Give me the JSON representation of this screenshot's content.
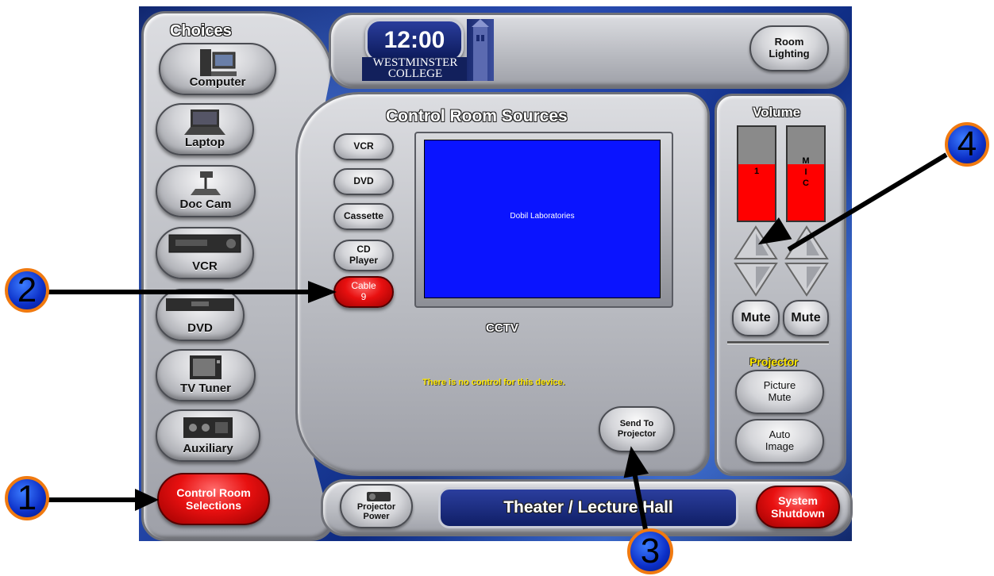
{
  "clock": "12:00",
  "logo_text": {
    "line1": "WESTMINSTER",
    "line2": "COLLEGE"
  },
  "room_lighting": {
    "line1": "Room",
    "line2": "Lighting"
  },
  "choices": {
    "title": "Choices",
    "items": [
      {
        "label": "Computer",
        "icon": "computer-icon"
      },
      {
        "label": "Laptop",
        "icon": "laptop-icon"
      },
      {
        "label": "Doc Cam",
        "icon": "doc-cam-icon"
      },
      {
        "label": "VCR",
        "icon": "vcr-icon"
      },
      {
        "label": "DVD",
        "icon": "dvd-icon"
      },
      {
        "label": "TV Tuner",
        "icon": "tv-icon"
      },
      {
        "label": "Auxiliary",
        "icon": "auxiliary-icon"
      }
    ],
    "control_room": {
      "line1": "Control Room",
      "line2": "Selections"
    }
  },
  "sources": {
    "title": "Control Room Sources",
    "buttons": [
      {
        "line1": "VCR",
        "line2": ""
      },
      {
        "line1": "DVD",
        "line2": ""
      },
      {
        "line1": "Cassette",
        "line2": ""
      },
      {
        "line1": "CD",
        "line2": "Player"
      },
      {
        "line1": "Cable",
        "line2": "9"
      }
    ],
    "preview_text": "Dobil Laboratories",
    "device_name": "CCTV",
    "message": "There is no control for this device.",
    "send_to_projector": {
      "line1": "Send To",
      "line2": "Projector"
    }
  },
  "volume": {
    "title": "Volume",
    "ch1_label": "1",
    "ch2_label": [
      "M",
      "I",
      "C"
    ],
    "ch1_level": 0.6,
    "ch2_level": 0.6,
    "mute1": "Mute",
    "mute2": "Mute"
  },
  "projector": {
    "title": "Projector",
    "picture_mute": {
      "line1": "Picture",
      "line2": "Mute"
    },
    "auto_image": {
      "line1": "Auto",
      "line2": "Image"
    }
  },
  "bottom": {
    "projector_power": {
      "line1": "Projector",
      "line2": "Power"
    },
    "room_name": "Theater / Lecture Hall",
    "shutdown": {
      "line1": "System",
      "line2": "Shutdown"
    }
  },
  "callouts": [
    "1",
    "2",
    "3",
    "4"
  ],
  "colors": {
    "accent_red": "#e81010",
    "screen_blue": "#0a14ff",
    "heading_yellow": "#ffd400",
    "volume_red": "#ff0000"
  }
}
